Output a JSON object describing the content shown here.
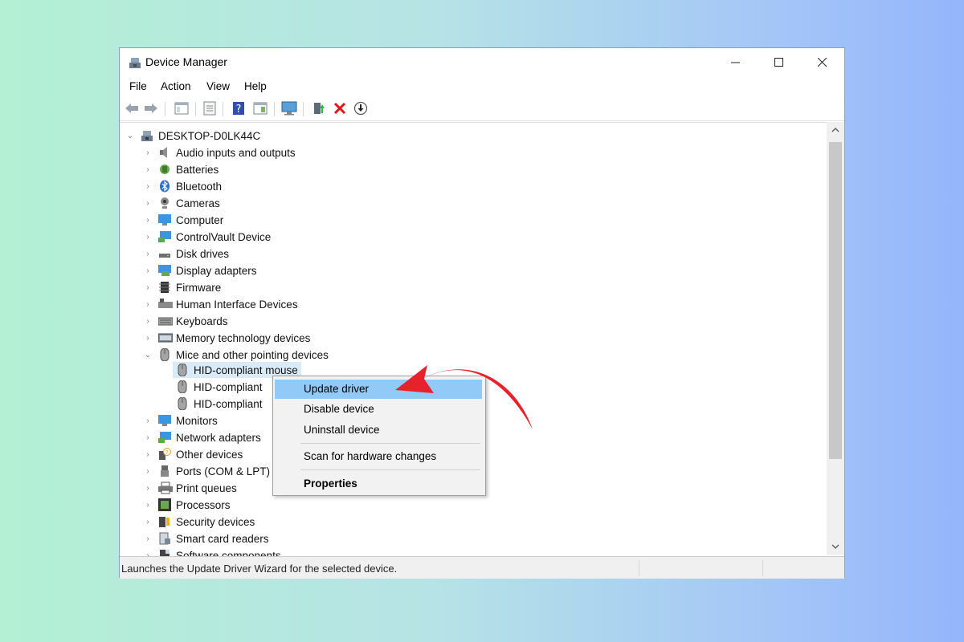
{
  "window": {
    "title": "Device Manager",
    "controls": {
      "minimize": "—",
      "maximize": "☐",
      "close": "✕"
    }
  },
  "menubar": [
    "File",
    "Action",
    "View",
    "Help"
  ],
  "tree": {
    "root": "DESKTOP-D0LK44C",
    "categories": [
      "Audio inputs and outputs",
      "Batteries",
      "Bluetooth",
      "Cameras",
      "Computer",
      "ControlVault Device",
      "Disk drives",
      "Display adapters",
      "Firmware",
      "Human Interface Devices",
      "Keyboards",
      "Memory technology devices",
      "Mice and other pointing devices",
      "Monitors",
      "Network adapters",
      "Other devices",
      "Ports (COM & LPT)",
      "Print queues",
      "Processors",
      "Security devices",
      "Smart card readers",
      "Software components"
    ],
    "mice_children": [
      "HID-compliant mouse",
      "HID-compliant",
      "HID-compliant"
    ]
  },
  "context_menu": {
    "items": [
      "Update driver",
      "Disable device",
      "Uninstall device",
      "Scan for hardware changes",
      "Properties"
    ]
  },
  "statusbar": {
    "text": "Launches the Update Driver Wizard for the selected device."
  },
  "colors": {
    "accent_arrow": "#e8222d",
    "menu_highlight": "#91c9f7",
    "selection": "#d9ebf9"
  }
}
